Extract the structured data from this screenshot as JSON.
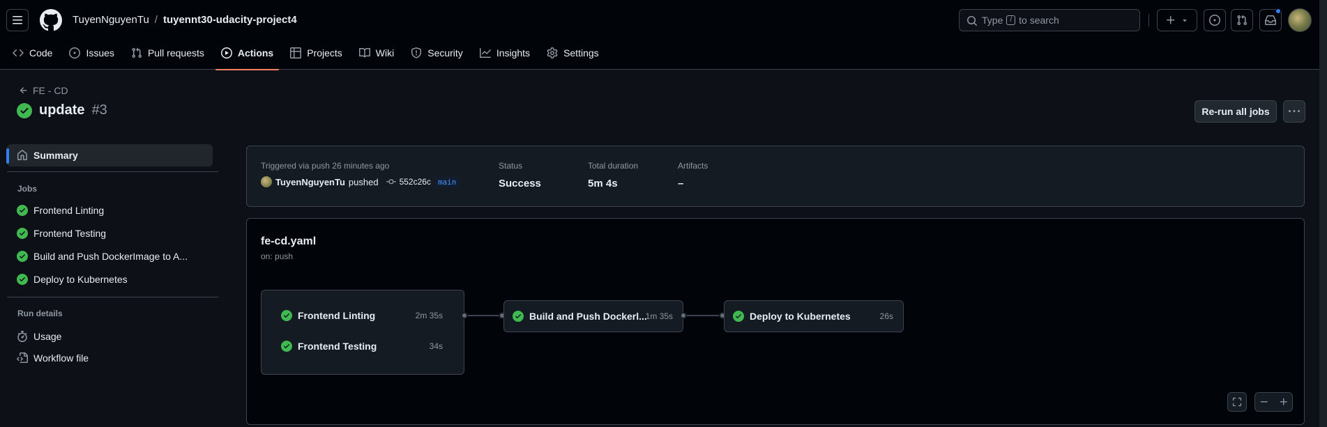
{
  "header": {
    "owner": "TuyenNguyenTu",
    "separator": "/",
    "repo": "tuyennt30-udacity-project4",
    "search_prefix": "Type",
    "search_key": "/",
    "search_suffix": "to search"
  },
  "tabs": [
    {
      "label": "Code",
      "icon": "code-icon"
    },
    {
      "label": "Issues",
      "icon": "issue-icon"
    },
    {
      "label": "Pull requests",
      "icon": "pull-request-icon"
    },
    {
      "label": "Actions",
      "icon": "play-icon",
      "active": true
    },
    {
      "label": "Projects",
      "icon": "table-icon"
    },
    {
      "label": "Wiki",
      "icon": "book-icon"
    },
    {
      "label": "Security",
      "icon": "shield-icon"
    },
    {
      "label": "Insights",
      "icon": "graph-icon"
    },
    {
      "label": "Settings",
      "icon": "gear-icon"
    }
  ],
  "run": {
    "workflow": "FE - CD",
    "title": "update",
    "number": "#3",
    "rerun_label": "Re-run all jobs"
  },
  "sidebar": {
    "summary": "Summary",
    "jobs_heading": "Jobs",
    "jobs": [
      "Frontend Linting",
      "Frontend Testing",
      "Build and Push DockerImage to A...",
      "Deploy to Kubernetes"
    ],
    "details_heading": "Run details",
    "details": [
      {
        "label": "Usage",
        "icon": "stopwatch-icon"
      },
      {
        "label": "Workflow file",
        "icon": "file-code-icon"
      }
    ]
  },
  "summary": {
    "trigger_text": "Triggered via push 26 minutes ago",
    "actor": "TuyenNguyenTu",
    "action": "pushed",
    "sha": "552c26c",
    "branch": "main",
    "status_label": "Status",
    "status_value": "Success",
    "duration_label": "Total duration",
    "duration_value": "5m 4s",
    "artifacts_label": "Artifacts",
    "artifacts_value": "–"
  },
  "workflow": {
    "file": "fe-cd.yaml",
    "trigger": "on: push",
    "jobs": [
      {
        "name": "Frontend Linting",
        "duration": "2m 35s"
      },
      {
        "name": "Frontend Testing",
        "duration": "34s"
      },
      {
        "name": "Build and Push Dockerl...",
        "duration": "1m 35s"
      },
      {
        "name": "Deploy to Kubernetes",
        "duration": "26s"
      }
    ]
  },
  "colors": {
    "success": "#3fb950",
    "accent_tab": "#f78166",
    "link": "#4493f8"
  }
}
